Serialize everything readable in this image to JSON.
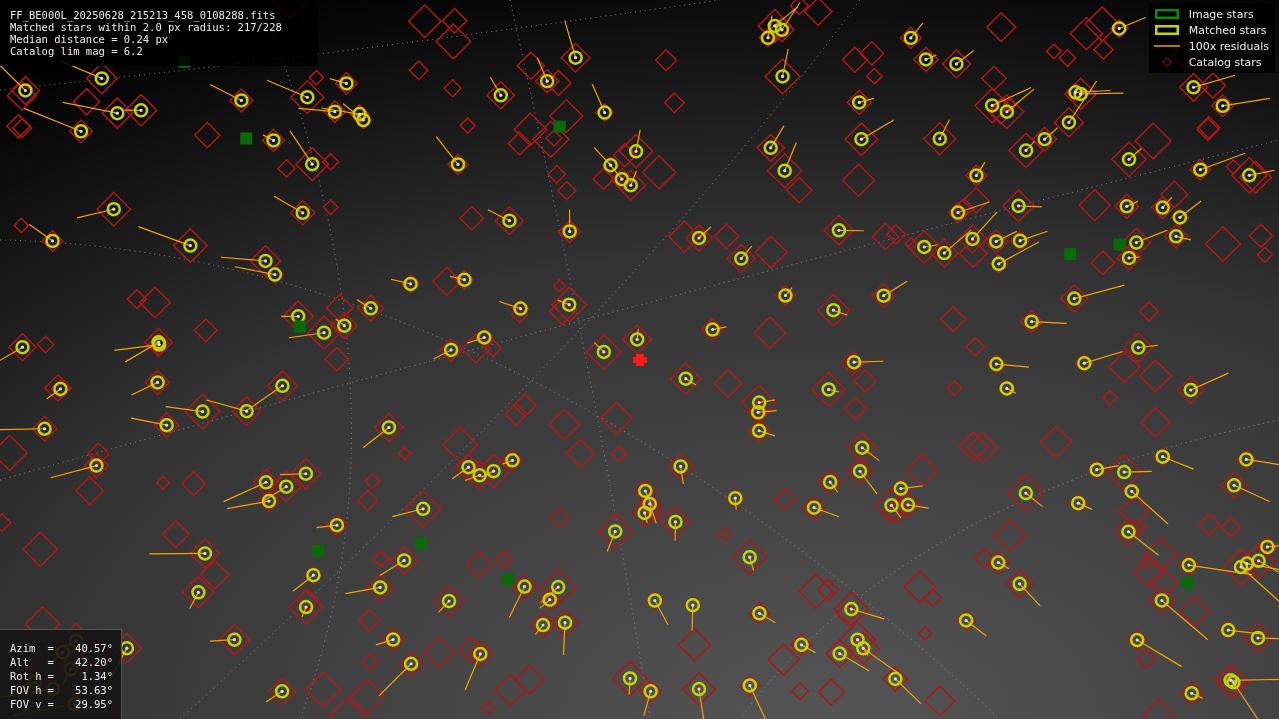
{
  "header": {
    "lines": [
      "FF_BE000L_20250628_215213_458_0108288.fits",
      "Matched stars within 2.0 px radius: 217/228",
      "Median distance = 0.24 px",
      "Catalog lim mag = 6.2"
    ]
  },
  "legend": [
    {
      "kind": "image",
      "label": "Image stars"
    },
    {
      "kind": "matched",
      "label": "Matched stars"
    },
    {
      "kind": "residual",
      "label": "100x residuals"
    },
    {
      "kind": "catalog",
      "label": "Catalog stars"
    }
  ],
  "pointing": [
    {
      "label": "Azim",
      "sign": "=",
      "value": "40.57°"
    },
    {
      "label": "Alt",
      "sign": "=",
      "value": "42.20°"
    },
    {
      "label": "Rot h",
      "sign": "=",
      "value": "1.34°"
    },
    {
      "label": "FOV h",
      "sign": "=",
      "value": "53.63°"
    },
    {
      "label": "FOV v",
      "sign": "=",
      "value": "29.95°"
    }
  ]
}
